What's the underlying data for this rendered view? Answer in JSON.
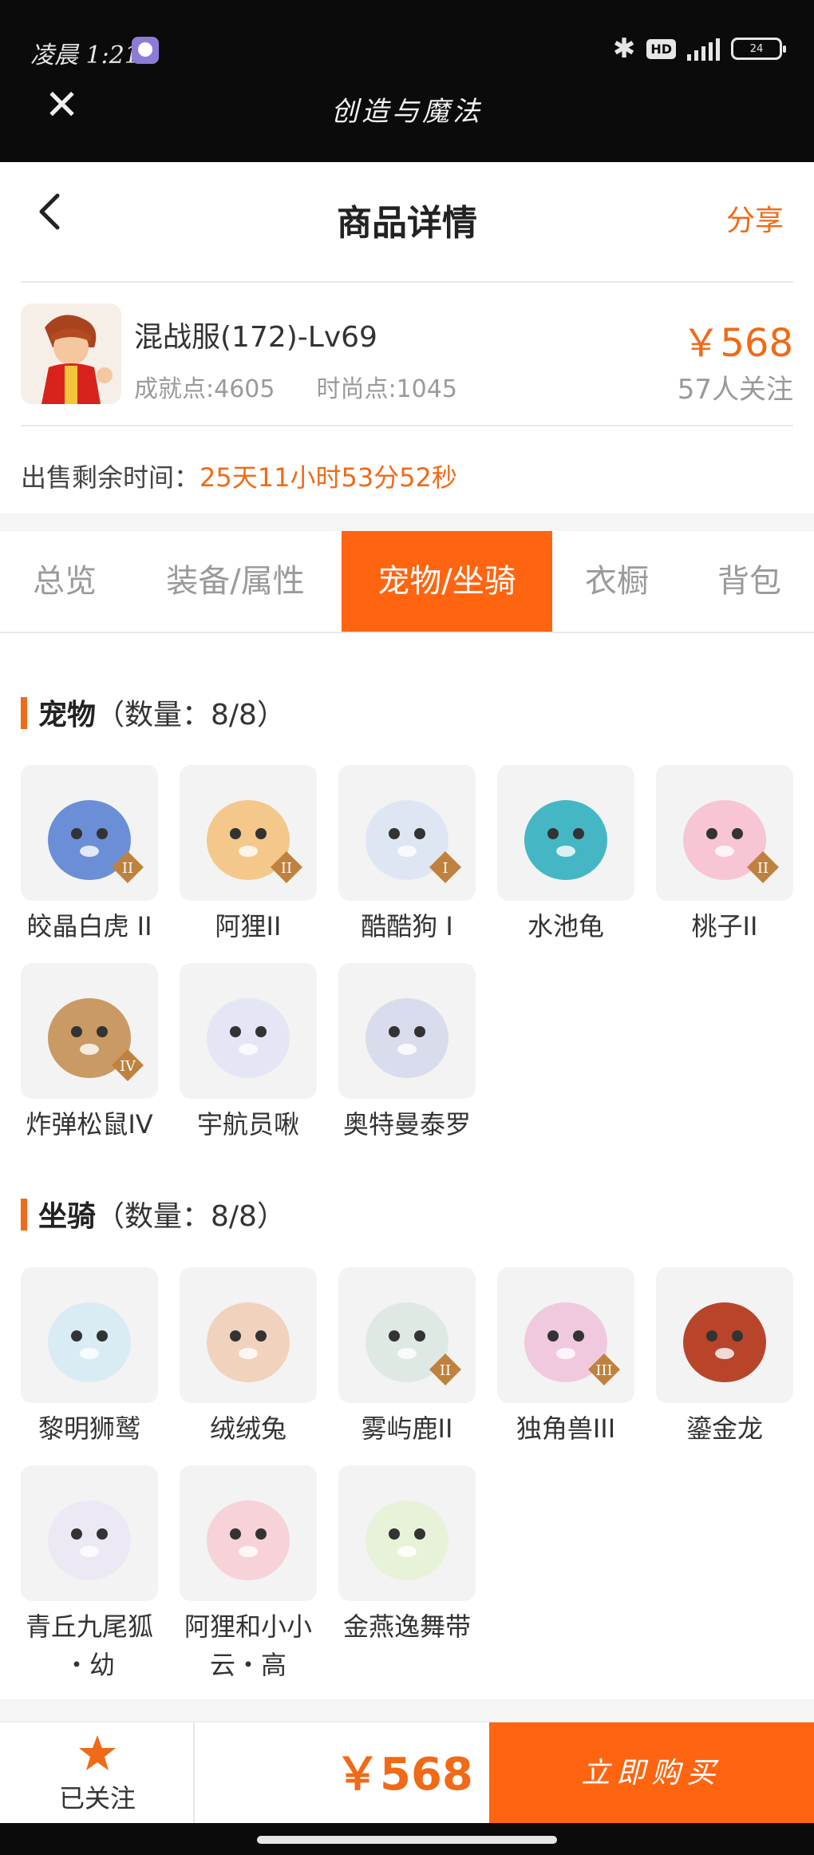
{
  "status_bar": {
    "time": "凌晨 1:21",
    "battery": "24",
    "network": "4G",
    "hd": "HD"
  },
  "app_title": "创造与魔法",
  "nav": {
    "title": "商品详情",
    "share": "分享"
  },
  "product": {
    "name": "混战服(172)-Lv69",
    "achievement": "成就点:4605",
    "fashion": "时尚点:1045",
    "price": "￥568",
    "followers": "57人关注",
    "remain_label": "出售剩余时间：",
    "remain_value": "25天11小时53分52秒"
  },
  "tabs": [
    "总览",
    "装备/属性",
    "宠物/坐骑",
    "衣橱",
    "背包"
  ],
  "active_tab": "宠物/坐骑",
  "pets": {
    "title": "宠物",
    "count": "（数量：8/8）",
    "items": [
      {
        "name": "皎晶白虎 II",
        "badge": "II"
      },
      {
        "name": "阿狸II",
        "badge": "II"
      },
      {
        "name": "酷酷狗 I",
        "badge": "I"
      },
      {
        "name": "水池龟",
        "badge": ""
      },
      {
        "name": "桃子II",
        "badge": "II"
      },
      {
        "name": "炸弹松鼠IV",
        "badge": "IV"
      },
      {
        "name": "宇航员啾",
        "badge": ""
      },
      {
        "name": "奥特曼泰罗",
        "badge": ""
      }
    ]
  },
  "mounts": {
    "title": "坐骑",
    "count": "（数量：8/8）",
    "items": [
      {
        "name": "黎明狮鹫",
        "badge": ""
      },
      {
        "name": "绒绒兔",
        "badge": ""
      },
      {
        "name": "雾屿鹿II",
        "badge": "II"
      },
      {
        "name": "独角兽III",
        "badge": "III"
      },
      {
        "name": "鎏金龙",
        "badge": ""
      },
      {
        "name": "青丘九尾狐",
        "name2": "・幼",
        "badge": ""
      },
      {
        "name": "阿狸和小小",
        "name2": "云・高",
        "badge": ""
      },
      {
        "name": "金燕逸舞带",
        "badge": ""
      }
    ]
  },
  "bottom": {
    "follow": "已关注",
    "price": "￥568",
    "buy": "立即购买"
  },
  "colors": {
    "accent": "#f06a17",
    "tab_active": "#ff6410",
    "dark": "#0b0b0b"
  }
}
